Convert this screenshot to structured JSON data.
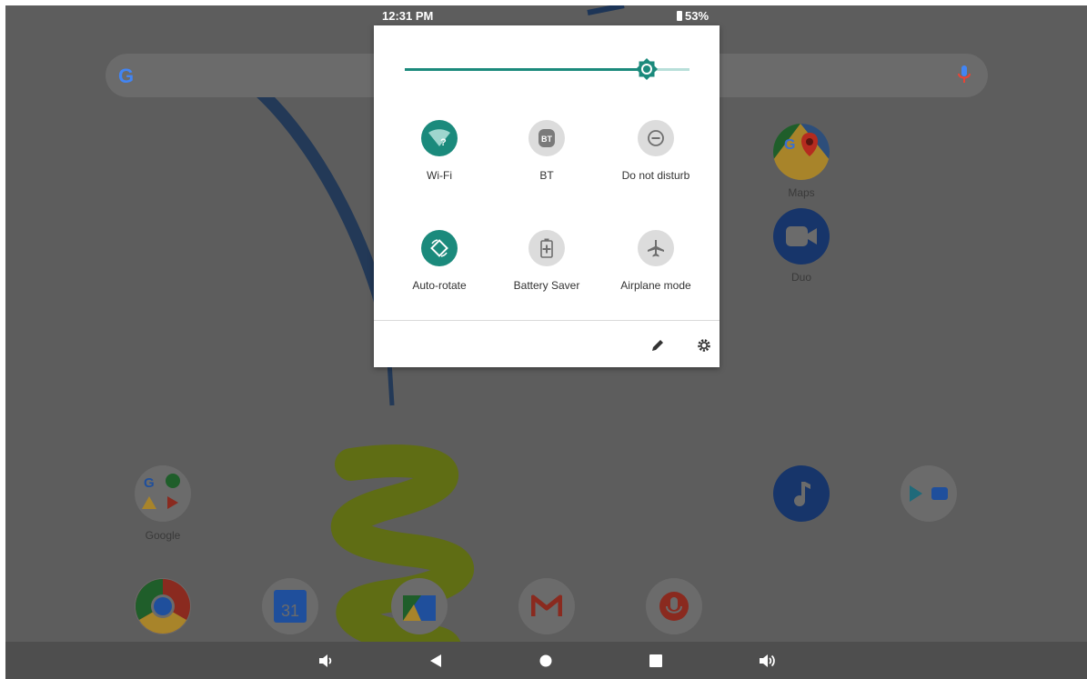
{
  "status_bar": {
    "time": "12:31 PM",
    "battery": "53%"
  },
  "search": {
    "logo": "G",
    "mic_icon": "mic-icon"
  },
  "brightness": {
    "level_fraction": 0.85
  },
  "tiles": [
    {
      "label": "Wi-Fi",
      "icon": "wifi-icon",
      "state": "on"
    },
    {
      "label": "BT",
      "icon": "bluetooth-icon",
      "state": "off"
    },
    {
      "label": "Do not disturb",
      "icon": "do-not-disturb-icon",
      "state": "off"
    },
    {
      "label": "Auto-rotate",
      "icon": "auto-rotate-icon",
      "state": "on"
    },
    {
      "label": "Battery Saver",
      "icon": "battery-saver-icon",
      "state": "off"
    },
    {
      "label": "Airplane mode",
      "icon": "airplane-icon",
      "state": "off"
    }
  ],
  "footer": {
    "edit_icon": "pencil-icon",
    "settings_icon": "gear-icon"
  },
  "home_apps": [
    {
      "label": "Maps",
      "icon": "maps-icon"
    },
    {
      "label": "Duo",
      "icon": "duo-icon"
    },
    {
      "label": "Google",
      "icon": "google-folder-icon"
    },
    {
      "label": "31",
      "icon": "calendar-icon"
    }
  ],
  "nav": [
    "volume-down-icon",
    "back-icon",
    "home-icon",
    "recents-icon",
    "volume-up-icon"
  ],
  "colors": {
    "accent": "#1b8a7c",
    "tile_off": "#dcdcdc",
    "scrim": "#5d5d5d"
  }
}
